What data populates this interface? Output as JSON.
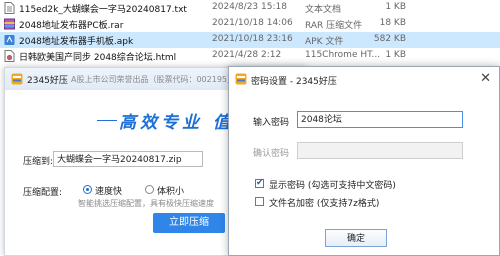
{
  "explorer": {
    "files": [
      {
        "name": "115ed2k_大蝴蝶会一字马20240817.txt",
        "date": "2024/8/23 15:18",
        "type": "文本文档",
        "size": "1 KB",
        "icon": "text-file-icon",
        "selected": false
      },
      {
        "name": "2048地址发布器PC板.rar",
        "date": "2021/10/18 14:06",
        "type": "RAR 压缩文件",
        "size": "18 KB",
        "icon": "rar-archive-icon",
        "selected": false
      },
      {
        "name": "2048地址发布器手机板.apk",
        "date": "2021/10/18 23:16",
        "type": "APK 文件",
        "size": "582 KB",
        "icon": "apk-file-icon",
        "selected": true
      },
      {
        "name": "日韩欧美国产同步 2048综合论坛.html",
        "date": "2021/4/28 2:12",
        "type": "115Chrome HT...",
        "size": "1 KB",
        "icon": "html-file-icon",
        "selected": false
      }
    ]
  },
  "main_window": {
    "title": "2345好压",
    "subtitle": "A股上市公司荣誉出品（股票代码：002195）",
    "slogan": "高效专业  值得",
    "compress_to_label": "压缩到:",
    "compress_to_value": "大蝴蝶会一字马20240817.zip",
    "config_label": "压缩配置:",
    "option_fast": "速度快",
    "option_small": "体积小",
    "hint": "智能挑选压缩配置，具有极快压缩速度",
    "compress_button": "立即压缩"
  },
  "password_dialog": {
    "title": "密码设置 - 2345好压",
    "password_label": "输入密码",
    "password_value": "2048论坛",
    "confirm_label": "确认密码",
    "show_password_label": "显示密码 (勾选可支持中文密码)",
    "show_password_checked": true,
    "encrypt_names_label": "文件名加密 (仅支持7z格式)",
    "encrypt_names_checked": false,
    "ok_button": "确定"
  },
  "colors": {
    "accent": "#2f86e8",
    "selection": "#cce8ff",
    "slogan": "#1e6fd6"
  }
}
